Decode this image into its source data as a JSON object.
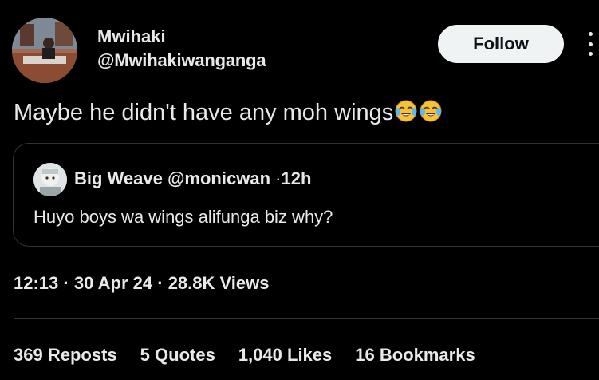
{
  "author": {
    "name": "Mwihaki",
    "handle": "@Mwihakiwanganga"
  },
  "follow_label": "Follow",
  "tweet": {
    "text": "Maybe he didn't have any moh wings",
    "emojis": [
      "tears-of-joy-emoji",
      "tears-of-joy-emoji"
    ]
  },
  "quote": {
    "name": "Big Weave",
    "handle": "@monicwan",
    "separator": "·",
    "time": "12h",
    "text": "Huyo boys wa wings alifunga biz why?"
  },
  "meta": {
    "time": "12:13",
    "separator": "·",
    "date": "30 Apr 24",
    "views_count": "28.8K",
    "views_label": "Views"
  },
  "stats": [
    {
      "num": "369",
      "label": "Reposts"
    },
    {
      "num": "5",
      "label": "Quotes"
    },
    {
      "num": "1,040",
      "label": "Likes"
    },
    {
      "num": "16",
      "label": "Bookmarks"
    }
  ],
  "colors": {
    "background": "#000000",
    "text": "#e7e9ea",
    "border": "#2f3336",
    "follow_bg": "#eff3f4"
  }
}
